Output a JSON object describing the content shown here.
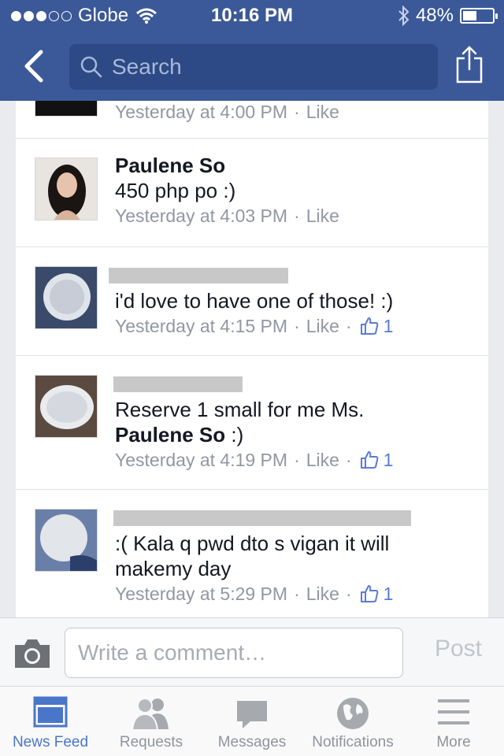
{
  "status_bar": {
    "carrier": "Globe",
    "time": "10:16 PM",
    "battery": "48%",
    "battery_level": 0.48,
    "signal_bars_filled": 3,
    "signal_bars_total": 5
  },
  "nav": {
    "search_placeholder": "Search"
  },
  "comments": [
    {
      "name": "",
      "text": "",
      "time": "Yesterday at 4:00 PM",
      "like_label": "Like",
      "likes": ""
    },
    {
      "name": "Paulene So",
      "text": "450 php po :)",
      "time": "Yesterday at 4:03 PM",
      "like_label": "Like",
      "likes": ""
    },
    {
      "name": "",
      "text": "i'd love to have one of those! :)",
      "time": "Yesterday at 4:15 PM",
      "like_label": "Like",
      "likes": "1"
    },
    {
      "name": "",
      "text": "Reserve 1 small for me Ms.",
      "mention": "Paulene So",
      "text_after": " :)",
      "time": "Yesterday at 4:19 PM",
      "like_label": "Like",
      "likes": "1"
    },
    {
      "name": "",
      "text": ":( Kala q pwd dto s vigan it will makemy day",
      "time": "Yesterday at 5:29 PM",
      "like_label": "Like",
      "likes": "1"
    }
  ],
  "composer": {
    "placeholder": "Write a comment…",
    "post_label": "Post"
  },
  "tabs": [
    {
      "label": "News Feed",
      "icon": "news-feed-icon",
      "active": true
    },
    {
      "label": "Requests",
      "icon": "friend-requests-icon",
      "active": false
    },
    {
      "label": "Messages",
      "icon": "messages-icon",
      "active": false
    },
    {
      "label": "Notifications",
      "icon": "globe-icon",
      "active": false
    },
    {
      "label": "More",
      "icon": "menu-icon",
      "active": false
    }
  ],
  "colors": {
    "brand": "#3b5998",
    "active_tab": "#4a76c9",
    "meta_text": "#9197a3"
  }
}
